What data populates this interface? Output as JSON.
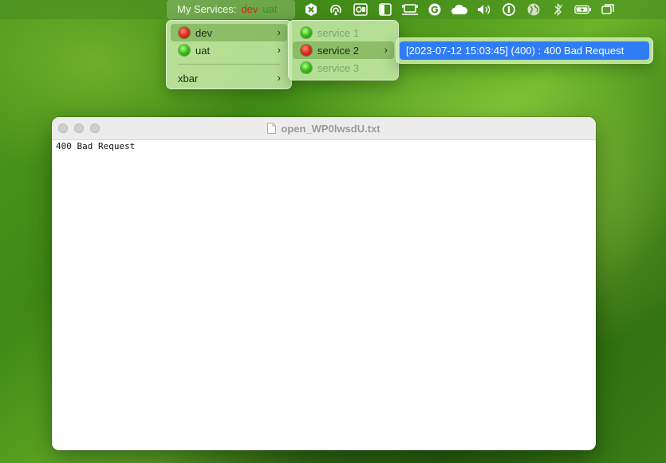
{
  "menubar": {
    "title_label": "My Services:",
    "title_env_dev": "dev",
    "title_env_uat": "uat",
    "tray_icons": [
      "xbar-icon",
      "airdrop-icon",
      "outlook-icon",
      "sidebar-icon",
      "display-icon",
      "grammarly-icon",
      "cloud-icon",
      "volume-icon",
      "onepassword-icon",
      "globe-icon",
      "bluetooth-icon",
      "battery-icon",
      "window-icon"
    ]
  },
  "envs_menu": {
    "items": [
      {
        "label": "dev",
        "status": "red"
      },
      {
        "label": "uat",
        "status": "green"
      }
    ],
    "xbar_label": "xbar"
  },
  "services_menu": {
    "items": [
      {
        "label": "service 1",
        "status": "green",
        "enabled": false
      },
      {
        "label": "service 2",
        "status": "red",
        "enabled": true
      },
      {
        "label": "service 3",
        "status": "green",
        "enabled": false
      }
    ]
  },
  "detail": {
    "text": "[2023-07-12 15:03:45] (400) : 400 Bad Request"
  },
  "window": {
    "title": "open_WP0lwsdU.txt",
    "content": "400 Bad Request"
  },
  "colors": {
    "accent": "#2f7cf6",
    "status_red": "#e1301f",
    "status_green": "#3cc21a"
  }
}
